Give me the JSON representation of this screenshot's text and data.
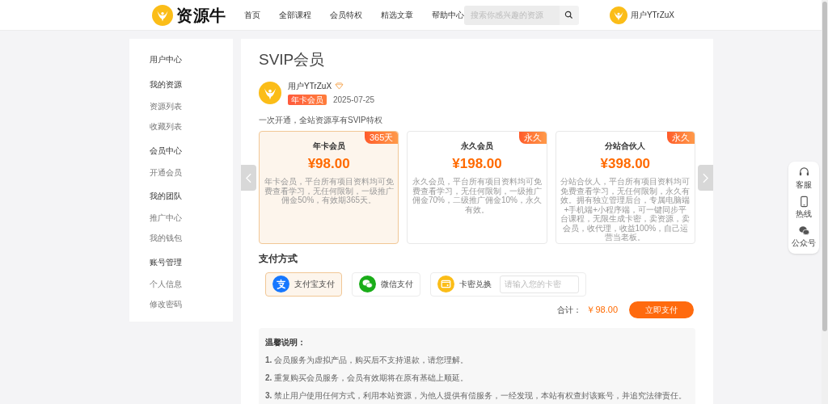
{
  "header": {
    "logo_text": "资源牛",
    "nav": [
      "首页",
      "全部课程",
      "会员特权",
      "精选文章",
      "帮助中心"
    ],
    "search": {
      "placeholder": "搜索你感兴趣的资源"
    },
    "user_name": "用户YTrZuX"
  },
  "sidebar": [
    {
      "title": "用户中心"
    },
    {
      "title": "我的资源",
      "items": [
        "资源列表",
        "收藏列表"
      ]
    },
    {
      "title": "会员中心",
      "items": [
        "开通会员"
      ]
    },
    {
      "title": "我的团队",
      "items": [
        "推广中心",
        "我的钱包"
      ]
    },
    {
      "title": "账号管理",
      "items": [
        "个人信息",
        "修改密码"
      ]
    }
  ],
  "main": {
    "title": "SVIP会员",
    "user": {
      "name": "用户YTrZuX",
      "badge": "年卡会员",
      "date": "2025-07-25"
    },
    "tagline": "一次开通，全站资源享有SVIP特权",
    "plans": [
      {
        "name": "年卡会员",
        "price": "¥98.00",
        "tag": "365天",
        "description": "年卡会员，平台所有项目资料均可免费查看学习，无任何限制，一级推广佣金50%，有效期365天。",
        "selected": true
      },
      {
        "name": "永久会员",
        "price": "¥198.00",
        "tag": "永久",
        "description": "永久会员，平台所有项目资料均可免费查看学习，无任何限制，一级推广佣金70%，二级推广佣金10%，永久有效。",
        "selected": false
      },
      {
        "name": "分站合伙人",
        "price": "¥398.00",
        "tag": "永久",
        "description": "分站合伙人，平台所有项目资料均可免费查看学习，无任何限制，永久有效。拥有独立管理后台，专属电脑端+手机端+小程序端，可一键同步平台课程，无限生成卡密，卖资源，卖会员，收代理，收益100%，自己运营当老板。",
        "selected": false
      }
    ],
    "payment": {
      "title": "支付方式",
      "methods": [
        {
          "kind": "alipay",
          "label": "支付宝支付",
          "selected": true
        },
        {
          "kind": "wechat",
          "label": "微信支付",
          "selected": false
        },
        {
          "kind": "card",
          "label": "卡密兑换",
          "selected": false,
          "placeholder": "请输入您的卡密"
        }
      ]
    },
    "total": {
      "label": "合计：",
      "amount": "￥98.00"
    },
    "pay_button": "立即支付",
    "notes": {
      "title": "温馨说明：",
      "items": [
        "**1.** 会员服务为虚拟产品，购买后不支持退款，请您理解。",
        "**2.** 重复购买会员服务，会员有效期将在原有基础上顺延。",
        "**3.** 禁止用户使用任何方式，利用本站资源，为他人提供有偿服务，一经发现，本站有权查封该账号，并追究法律责任。"
      ]
    }
  },
  "float_toolbar": [
    "客服",
    "热线",
    "公众号"
  ]
}
